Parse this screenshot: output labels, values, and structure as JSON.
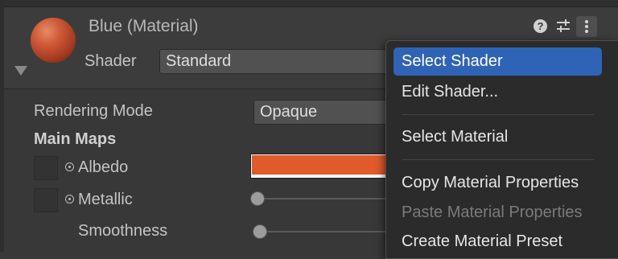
{
  "header": {
    "title": "Blue (Material)",
    "shader_label": "Shader",
    "shader_value": "Standard"
  },
  "properties": {
    "rendering_mode_label": "Rendering Mode",
    "rendering_mode_value": "Opaque",
    "main_maps_label": "Main Maps",
    "albedo_label": "Albedo",
    "albedo_color": "#e05a2b",
    "metallic_label": "Metallic",
    "metallic_value": 0,
    "smoothness_label": "Smoothness",
    "smoothness_value": 0
  },
  "context_menu": {
    "items": [
      {
        "label": "Select Shader",
        "state": "highlighted"
      },
      {
        "label": "Edit Shader...",
        "state": "enabled"
      },
      {
        "label": "Select Material",
        "state": "enabled"
      },
      {
        "label": "Copy Material Properties",
        "state": "enabled"
      },
      {
        "label": "Paste Material Properties",
        "state": "disabled"
      },
      {
        "label": "Create Material Preset",
        "state": "enabled"
      }
    ]
  },
  "icons": {
    "help": "help-icon",
    "presets": "sliders-icon",
    "more": "kebab-icon",
    "help_glyph": "?"
  },
  "colors": {
    "accent": "#2f63b6",
    "material_preview": "#cf5a37"
  }
}
